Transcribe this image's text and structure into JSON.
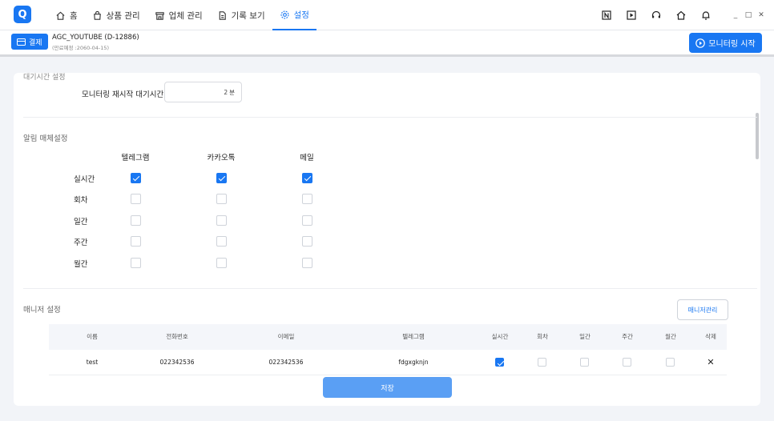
{
  "app": {
    "logo_text": "Q",
    "accent": "#1977f2"
  },
  "nav": [
    {
      "icon": "home-icon",
      "label": "홈"
    },
    {
      "icon": "bag-icon",
      "label": "상품 관리"
    },
    {
      "icon": "store-icon",
      "label": "업체 관리"
    },
    {
      "icon": "document-icon",
      "label": "기록 보기"
    },
    {
      "icon": "gear-icon",
      "label": "설정",
      "active": true
    }
  ],
  "toolbar_icons": [
    "notion-icon",
    "play-icon",
    "headset-icon",
    "home-icon",
    "bell-icon"
  ],
  "window_controls": {
    "minimize": "_",
    "maximize": "□",
    "close": "✕"
  },
  "subbar": {
    "pay_label": "결제",
    "account_name": "AGC_YOUTUBE (D-12886)",
    "account_expiry": "(만료예정 :2060-04-15)",
    "monitor_label": "모니터링 시작"
  },
  "wait": {
    "section_label": "대기시간 설정",
    "label": "모니터링 재시작 대기시간",
    "value": "2",
    "unit": "분"
  },
  "alerts": {
    "title": "알림 매체설정",
    "columns": [
      "텔레그램",
      "카카오톡",
      "메일"
    ],
    "rows": [
      {
        "label": "실시간",
        "checks": [
          true,
          true,
          true
        ]
      },
      {
        "label": "회차",
        "checks": [
          false,
          false,
          false
        ]
      },
      {
        "label": "일간",
        "checks": [
          false,
          false,
          false
        ]
      },
      {
        "label": "주간",
        "checks": [
          false,
          false,
          false
        ]
      },
      {
        "label": "월간",
        "checks": [
          false,
          false,
          false
        ]
      }
    ]
  },
  "managers": {
    "title": "매니저 설정",
    "manage_button": "매니저관리",
    "headers": [
      "이름",
      "전화번호",
      "이메일",
      "텔레그램",
      "실시간",
      "회차",
      "일간",
      "주간",
      "월간",
      "삭제"
    ],
    "rows": [
      {
        "name": "test",
        "phone": "022342536",
        "email": "022342536",
        "telegram": "fdgxgknjn",
        "checks": [
          true,
          false,
          false,
          false,
          false
        ],
        "delete": "✕"
      }
    ]
  },
  "save_label": "저장"
}
